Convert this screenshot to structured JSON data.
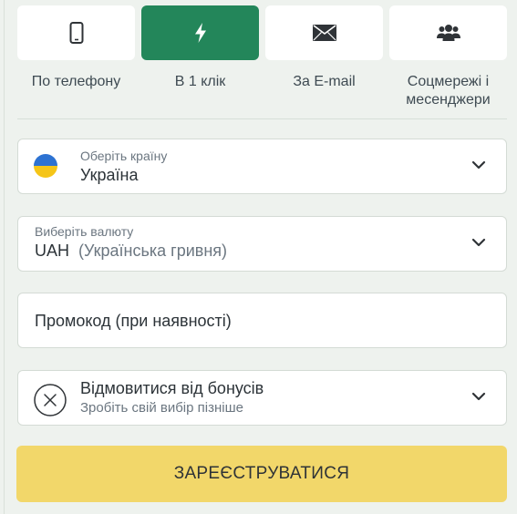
{
  "tabs": [
    {
      "label": "По телефону",
      "icon": "phone-icon"
    },
    {
      "label": "В 1 клік",
      "icon": "lightning-icon",
      "active": true
    },
    {
      "label": "За E-mail",
      "icon": "envelope-icon"
    },
    {
      "label": "Соцмережі і месенджери",
      "icon": "users-icon"
    }
  ],
  "country": {
    "label": "Оберіть країну",
    "value": "Україна",
    "flag_colors": [
      "#2d72d2",
      "#f5c518"
    ]
  },
  "currency": {
    "label": "Виберіть валюту",
    "code": "UAH",
    "name": "(Українська гривня)"
  },
  "promo": {
    "placeholder": "Промокод (при наявності)"
  },
  "bonus": {
    "title": "Відмовитися від бонусів",
    "subtitle": "Зробіть свій вибір пізніше"
  },
  "submit": {
    "label": "ЗАРЕЄСТРУВАТИСЯ"
  },
  "colors": {
    "accent": "#23865a",
    "button": "#f2d76a",
    "background": "#eef2ee"
  }
}
